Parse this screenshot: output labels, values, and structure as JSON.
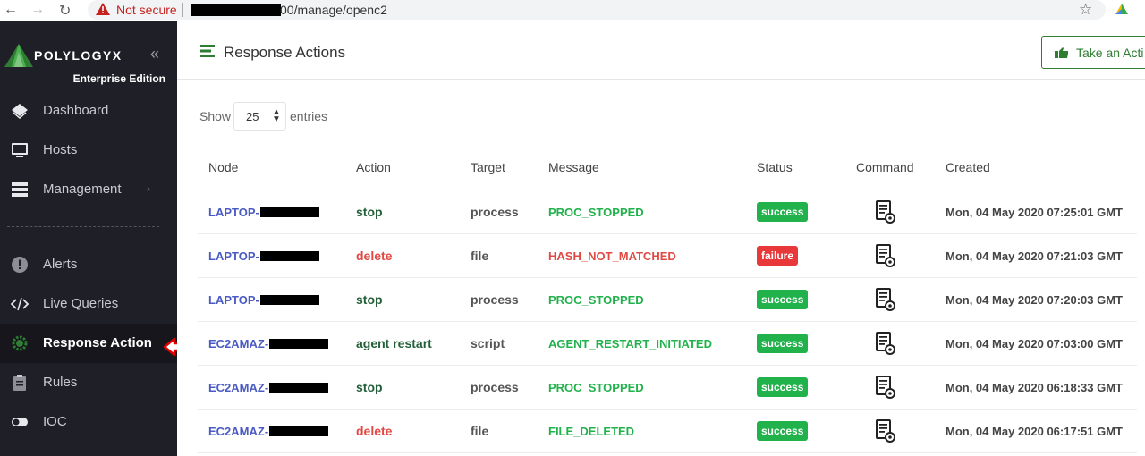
{
  "browser": {
    "not_secure": "Not secure",
    "url_suffix": "00/manage/openc2"
  },
  "sidebar": {
    "brand": "POLYLOGYX",
    "edition": "Enterprise Edition",
    "items": [
      {
        "label": "Dashboard",
        "icon": "layers-icon"
      },
      {
        "label": "Hosts",
        "icon": "monitor-icon"
      },
      {
        "label": "Management",
        "icon": "server-icon"
      },
      {
        "label": "Alerts",
        "icon": "alert-circle-icon"
      },
      {
        "label": "Live Queries",
        "icon": "code-icon"
      },
      {
        "label": "Response Action",
        "icon": "gear-icon"
      },
      {
        "label": "Rules",
        "icon": "clipboard-icon"
      },
      {
        "label": "IOC",
        "icon": "toggle-icon"
      }
    ]
  },
  "header": {
    "title": "Response Actions",
    "take_action": "Take an Acti"
  },
  "table_controls": {
    "show": "Show",
    "page_size": "25",
    "entries": "entries"
  },
  "table": {
    "columns": [
      "Node",
      "Action",
      "Target",
      "Message",
      "Status",
      "Command",
      "Created"
    ],
    "rows": [
      {
        "node": "LAPTOP-",
        "action": "stop",
        "target": "process",
        "message": "PROC_STOPPED",
        "status": "success",
        "created": "Mon, 04 May 2020 07:25:01 GMT"
      },
      {
        "node": "LAPTOP-",
        "action": "delete",
        "target": "file",
        "message": "HASH_NOT_MATCHED",
        "status": "failure",
        "created": "Mon, 04 May 2020 07:21:03 GMT"
      },
      {
        "node": "LAPTOP-",
        "action": "stop",
        "target": "process",
        "message": "PROC_STOPPED",
        "status": "success",
        "created": "Mon, 04 May 2020 07:20:03 GMT"
      },
      {
        "node": "EC2AMAZ-",
        "action": "agent restart",
        "target": "script",
        "message": "AGENT_RESTART_INITIATED",
        "status": "success",
        "created": "Mon, 04 May 2020 07:03:00 GMT"
      },
      {
        "node": "EC2AMAZ-",
        "action": "stop",
        "target": "process",
        "message": "PROC_STOPPED",
        "status": "success",
        "created": "Mon, 04 May 2020 06:18:33 GMT"
      },
      {
        "node": "EC2AMAZ-",
        "action": "delete",
        "target": "file",
        "message": "FILE_DELETED",
        "status": "success",
        "created": "Mon, 04 May 2020 06:17:51 GMT"
      }
    ]
  },
  "colors": {
    "sidebar_bg": "#1f1f27",
    "accent_green": "#2e7d32",
    "success": "#21b24c",
    "failure": "#e8383a",
    "link": "#4b5bc4"
  }
}
